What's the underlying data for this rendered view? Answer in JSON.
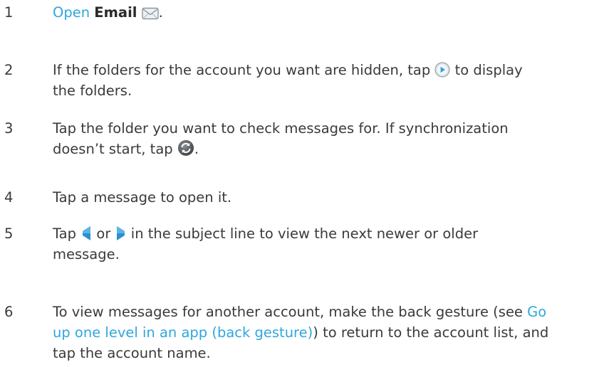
{
  "steps": [
    {
      "num": "1",
      "link": "Open",
      "bold": "Email",
      "after": ".",
      "icon": "envelope-icon"
    },
    {
      "num": "2",
      "before": "If the folders for the account you want are hidden, tap",
      "after_line1": "to display",
      "line2": "the folders.",
      "icon": "play-circle-icon"
    },
    {
      "num": "3",
      "line1": "Tap the folder you want to check messages for. If synchronization",
      "before": "doesn’t start, tap",
      "after": ".",
      "icon": "sync-icon"
    },
    {
      "num": "4",
      "line1": "Tap a message to open it."
    },
    {
      "num": "5",
      "before": "Tap",
      "middle": "or",
      "after_line1": "in the subject line to view the next newer or older",
      "line2": "message.",
      "icons": [
        "prev-message-icon",
        "next-message-icon"
      ]
    },
    {
      "num": "6",
      "line1_before": "To view messages for another account, make the back gesture (see",
      "line1_link": "Go",
      "line2_link": "up one level in an app (back gesture)",
      "line2_after": ") to return to the account list, and",
      "line3": "tap the account name."
    }
  ],
  "colors": {
    "text": "#3a3a3a",
    "link": "#2fa7de"
  }
}
